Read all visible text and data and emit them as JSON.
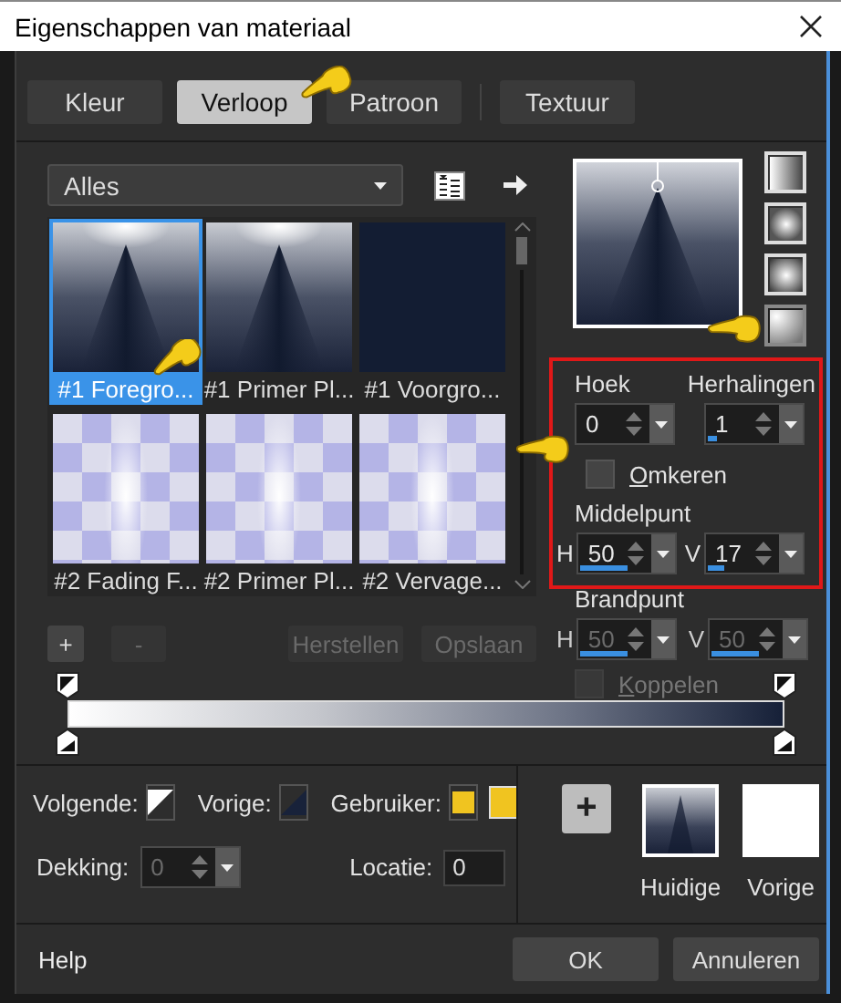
{
  "window": {
    "title": "Eigenschappen van materiaal"
  },
  "tabs": [
    {
      "label": "Kleur",
      "selected": false
    },
    {
      "label": "Verloop",
      "selected": true
    },
    {
      "label": "Patroon",
      "selected": false
    },
    {
      "label": "Textuur",
      "selected": false
    }
  ],
  "category": {
    "value": "Alles"
  },
  "gradients": [
    {
      "label": "#1 Foregro...",
      "selected": true,
      "kind": "fan"
    },
    {
      "label": "#1 Primer Pl...",
      "selected": false,
      "kind": "fan"
    },
    {
      "label": "#1 Voorgro...",
      "selected": false,
      "kind": "solid"
    },
    {
      "label": "#2 Fading F...",
      "selected": false,
      "kind": "checker"
    },
    {
      "label": "#2 Primer Pl...",
      "selected": false,
      "kind": "checker"
    },
    {
      "label": "#2 Vervage...",
      "selected": false,
      "kind": "checker"
    }
  ],
  "styles": [
    {
      "kind": "linear",
      "selected": false
    },
    {
      "kind": "rectangular",
      "selected": false
    },
    {
      "kind": "sunburst",
      "selected": false
    },
    {
      "kind": "radial",
      "selected": true
    }
  ],
  "angle": {
    "label": "Hoek",
    "value": "0"
  },
  "repeats": {
    "label": "Herhalingen",
    "value": "1",
    "level": 0.1
  },
  "invert": {
    "label": "Omkeren",
    "checked": false
  },
  "center": {
    "label": "Middelpunt",
    "h": {
      "label": "H",
      "value": "50",
      "level": 0.5
    },
    "v": {
      "label": "V",
      "value": "17",
      "level": 0.17
    }
  },
  "focus": {
    "label": "Brandpunt",
    "disabled": true,
    "h": {
      "label": "H",
      "value": "50",
      "level": 0.5
    },
    "v": {
      "label": "V",
      "value": "50",
      "level": 0.5
    }
  },
  "link": {
    "label": "Koppelen",
    "checked": false,
    "disabled": true
  },
  "stop_buttons": [
    {
      "label": "+",
      "disabled": false
    },
    {
      "label": "-",
      "disabled": true
    }
  ],
  "preset_buttons": [
    {
      "label": "Herstellen",
      "disabled": true
    },
    {
      "label": "Opslaan",
      "disabled": true
    }
  ],
  "stop_colors": {
    "next_label": "Volgende:",
    "previous_label": "Vorige:",
    "user_label": "Gebruiker:"
  },
  "opacity": {
    "label": "Dekking:",
    "value": "0",
    "disabled": true
  },
  "location": {
    "label": "Locatie:",
    "value": "0"
  },
  "swatches": {
    "add": "+",
    "current": "Huidige",
    "previous": "Vorige"
  },
  "footer": {
    "help": "Help",
    "buttons": [
      {
        "label": "OK"
      },
      {
        "label": "Annuleren"
      }
    ]
  }
}
